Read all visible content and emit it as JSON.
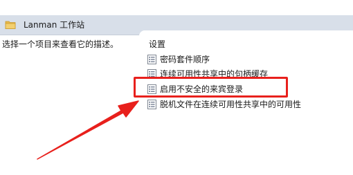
{
  "header": {
    "title": "Lanman 工作站",
    "icon": "folder-icon"
  },
  "description": "选择一个项目来查看它的描述。",
  "settings": {
    "heading": "设置",
    "items": [
      {
        "label": "密码套件顺序",
        "icon": "policy-setting-icon"
      },
      {
        "label": "连续可用性共享中的句柄缓存",
        "icon": "policy-setting-icon"
      },
      {
        "label": "启用不安全的来宾登录",
        "icon": "policy-setting-icon"
      },
      {
        "label": "脱机文件在连续可用性共享中的可用性",
        "icon": "policy-setting-icon"
      }
    ]
  },
  "annotation": {
    "highlighted_item": "启用不安全的来宾登录",
    "color": "#e8201c"
  },
  "colors": {
    "header_bar": "#d8dfe9",
    "folder": "#e8b84a"
  }
}
